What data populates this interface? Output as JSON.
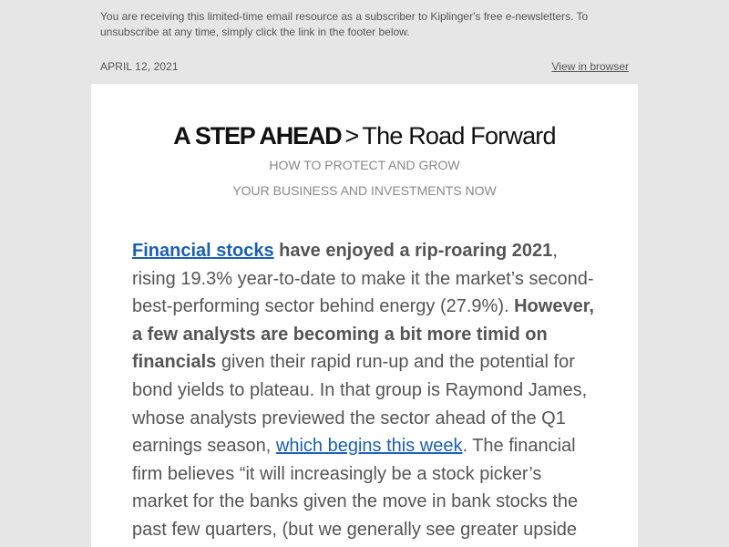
{
  "preheader": {
    "text": "You are receiving this limited-time email resource as a subscriber to Kiplinger's free e-newsletters. To unsubscribe at any time, simply click the link in the footer below."
  },
  "meta": {
    "date": "APRIL 12, 2021",
    "view_in_browser": "View in browser"
  },
  "masthead": {
    "title_bold": "A STEP AHEAD",
    "separator": ">",
    "title_light": "The Road Forward",
    "tagline_line1": "HOW TO PROTECT AND GROW",
    "tagline_line2": "YOUR BUSINESS AND INVESTMENTS NOW"
  },
  "article": {
    "link_financial_stocks": "Financial stocks",
    "bold_1": " have enjoyed a rip-roaring 2021",
    "text_1": ", rising 19.3% year-to-date to make it the market’s second-best-performing sector behind energy (27.9%). ",
    "bold_2": "However, a few analysts are becoming a bit more timid on financials",
    "text_2": " given their rapid run-up and the potential for bond yields to plateau. In that group is Raymond James, whose analysts previewed the sector ahead of the Q1 earnings season, ",
    "link_earnings_season": "which begins this week",
    "text_3": ". The financial firm believes “it will increasingly be a stock picker’s market for the banks given the move in bank stocks the past few quarters, (but we generally see greater upside"
  },
  "colors": {
    "page_background": "#e6e6e6",
    "card_background": "#ffffff",
    "link": "#1a5fb4",
    "body_text": "#555555",
    "tagline": "#888888",
    "masthead": "#111111"
  }
}
